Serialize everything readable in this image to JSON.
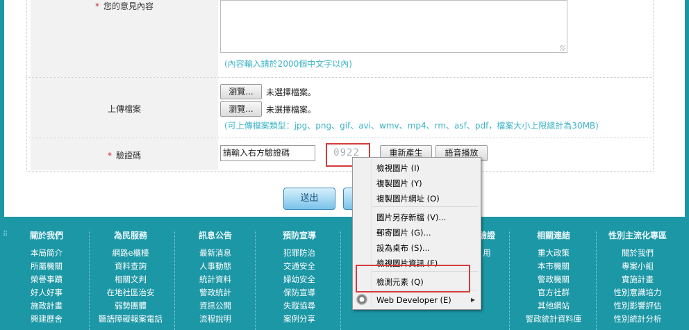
{
  "form": {
    "opinion_label": "您的意見內容",
    "opinion_hint": "(內容輸入請於2000個中文字以內)",
    "upload_label": "上傳檔案",
    "browse_label": "瀏覽...",
    "no_file": "未選擇檔案。",
    "upload_hint": "(可上傳檔案類型：jpg、png、gif、avi、wmv、mp4、rm、asf、pdf，檔案大小上限總計為30MB)",
    "captcha_label": "驗證碼",
    "required_mark": "*",
    "captcha_placeholder": "請輸入右方驗證碼",
    "captcha_code": "0922",
    "regen_label": "重新產生",
    "audio_label": "語音播放",
    "submit_label": "送出"
  },
  "footer": {
    "columns": [
      {
        "heading": "關於我們",
        "items": [
          "本局簡介",
          "所屬機關",
          "榮譽事蹟",
          "好人好事",
          "施政計畫",
          "興建歷舍"
        ]
      },
      {
        "heading": "為民服務",
        "items": [
          "網路e櫃檯",
          "資料查詢",
          "相關文判",
          "在地社區治安",
          "弱勢團體",
          "聽語障礙報案電話"
        ]
      },
      {
        "heading": "訊息公告",
        "items": [
          "最新消息",
          "人事動態",
          "統計資料",
          "警政統計",
          "資訊公開",
          "流程說明"
        ]
      },
      {
        "heading": "預防宣導",
        "items": [
          "犯罪防治",
          "交通安全",
          "婦幼安全",
          "保防宣導",
          "失蹤協尋",
          "案例分享"
        ]
      },
      {
        "heading": "驗證",
        "items": [
          "用"
        ]
      },
      {
        "heading": "相關連結",
        "items": [
          "重大政策",
          "本市機關",
          "警政機關",
          "官方社群",
          "其他網站",
          "警政統計資料庫"
        ]
      },
      {
        "heading": "性別主流化專區",
        "items": [
          "關於我們",
          "專案小組",
          "實施計畫",
          "性別意識培力",
          "性別影響評估",
          "性別統計分析"
        ]
      }
    ]
  },
  "context_menu": {
    "items": [
      "檢視圖片 (I)",
      "複製圖片 (Y)",
      "複製圖片網址 (O)",
      "圖片另存新檔 (V)...",
      "郵寄圖片 (G)...",
      "設為桌布 (S)...",
      "檢視圖片資訊 (F)",
      "檢測元素 (Q)",
      "Web Developer (E)"
    ]
  },
  "colors": {
    "footer_bg": "#1c97a6",
    "hint": "#3cb3c8",
    "required": "#d2233b",
    "highlight_box": "#d43b3b"
  }
}
